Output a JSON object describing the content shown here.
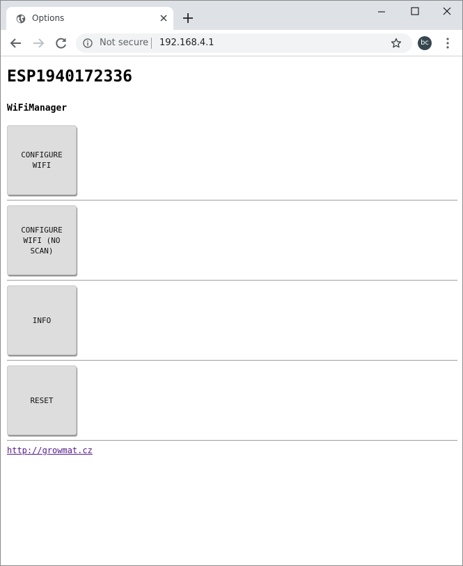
{
  "browser": {
    "tab_title": "Options",
    "security_label": "Not secure",
    "url": "192.168.4.1",
    "profile_initials": "bc"
  },
  "page": {
    "title": "ESP1940172336",
    "subtitle": "WiFiManager",
    "buttons": [
      {
        "label": "CONFIGURE WIFI"
      },
      {
        "label": "CONFIGURE WIFI (NO SCAN)"
      },
      {
        "label": "INFO"
      },
      {
        "label": "RESET"
      }
    ],
    "footer_link": "http://growmat.cz"
  },
  "icons": {
    "tab_favicon": "globe-icon",
    "tab_close": "close-icon",
    "new_tab": "plus-icon",
    "back": "arrow-left-icon",
    "forward": "arrow-right-icon",
    "reload": "reload-icon",
    "site_info": "info-icon",
    "bookmark": "star-icon",
    "menu": "kebab-menu-icon"
  },
  "colors": {
    "tabstrip_bg": "#dee1e6",
    "button_bg": "#dddddd",
    "link_visited": "#551a8b"
  }
}
